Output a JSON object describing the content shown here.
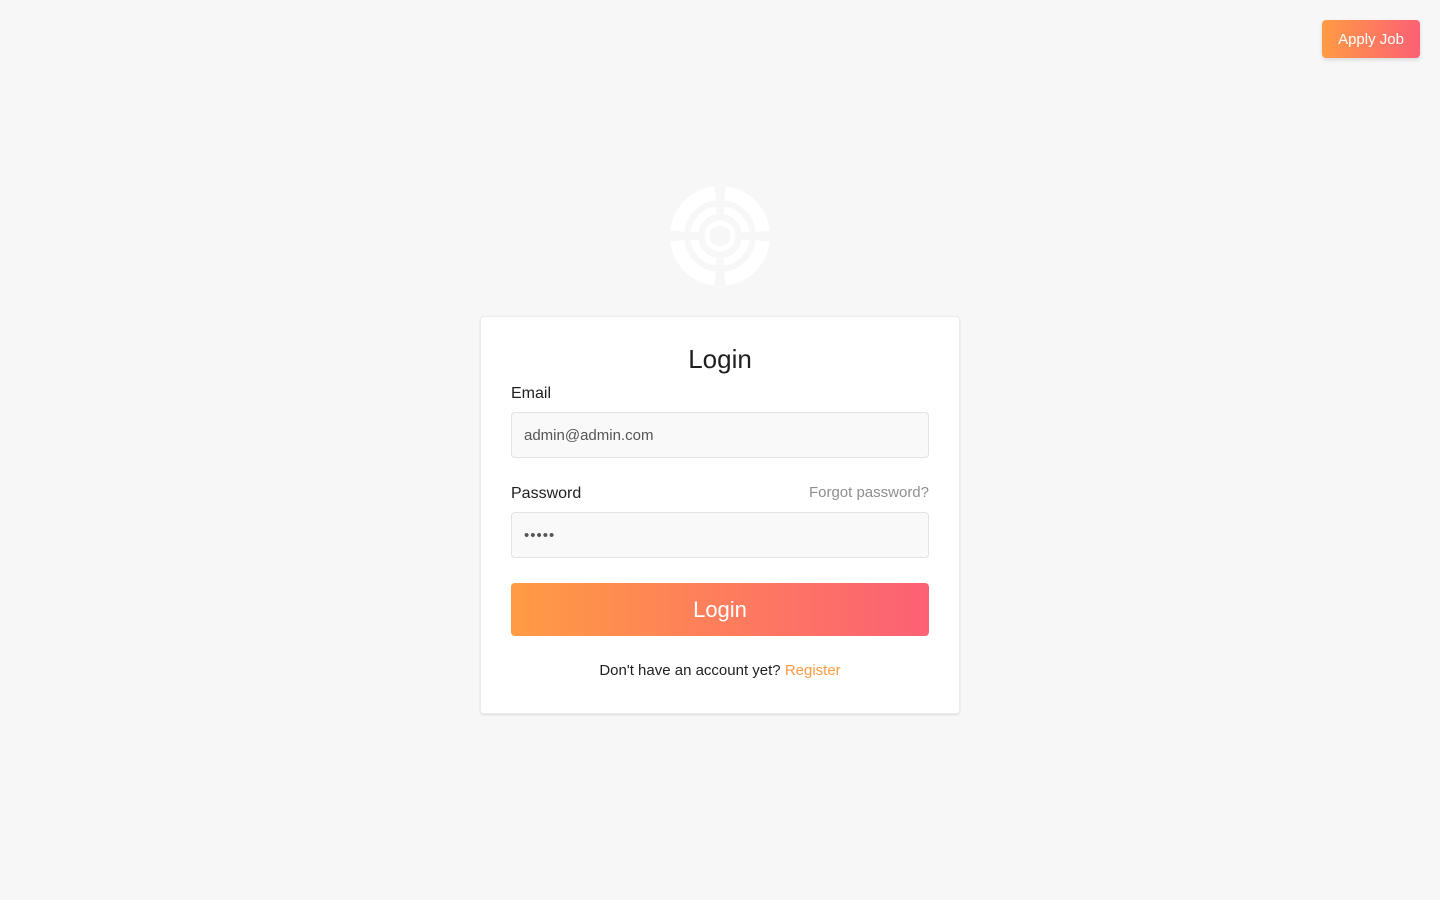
{
  "header": {
    "apply_job_label": "Apply Job"
  },
  "logo": {
    "icon": "target-logo-icon",
    "color": "#ffffff"
  },
  "login_form": {
    "title": "Login",
    "email_label": "Email",
    "email_value": "admin@admin.com",
    "password_label": "Password",
    "password_value": "•••••",
    "forgot_password_label": "Forgot password?",
    "submit_label": "Login",
    "register_prompt": "Don't have an account yet?",
    "register_label": "Register"
  },
  "colors": {
    "background": "#f7f7f7",
    "accent_start": "#ff9b44",
    "accent_end": "#fc6075",
    "link_accent": "#ff9b44",
    "muted_text": "#8e8e8e"
  }
}
